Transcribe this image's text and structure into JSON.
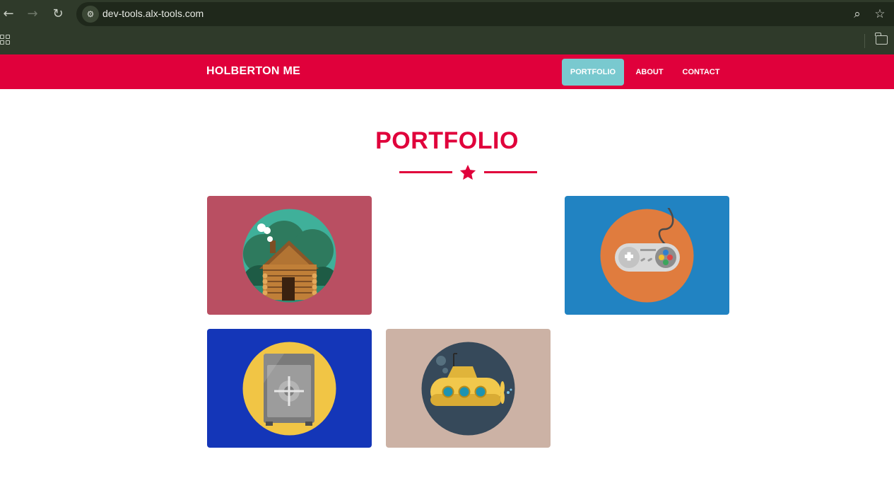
{
  "browser": {
    "url": "dev-tools.alx-tools.com",
    "icons": [
      "back-arrow-icon",
      "forward-arrow-icon",
      "reload-icon",
      "site-settings-icon",
      "zoom-icon",
      "bookmark-star-icon",
      "apps-grid-icon",
      "folder-icon"
    ]
  },
  "header": {
    "brand": "HOLBERTON ME",
    "nav": [
      {
        "label": "PORTFOLIO",
        "active": true
      },
      {
        "label": "ABOUT",
        "active": false
      },
      {
        "label": "CONTACT",
        "active": false
      }
    ],
    "color": "#e0003b",
    "active_color": "#79c9cf"
  },
  "portfolio": {
    "title": "PORTFOLIO",
    "items": [
      {
        "name": "cabin",
        "icon": "log-cabin-icon",
        "bg": "#b94f62",
        "circle": "#3fb09a"
      },
      {
        "name": "game-controller",
        "icon": "game-controller-icon",
        "bg": "#2183c2",
        "circle": "#e07c3e"
      },
      {
        "name": "safe",
        "icon": "safe-icon",
        "bg": "#1436b8",
        "circle": "#f1c545"
      },
      {
        "name": "submarine",
        "icon": "submarine-icon",
        "bg": "#ccb2a5",
        "circle": "#36495a"
      }
    ]
  }
}
